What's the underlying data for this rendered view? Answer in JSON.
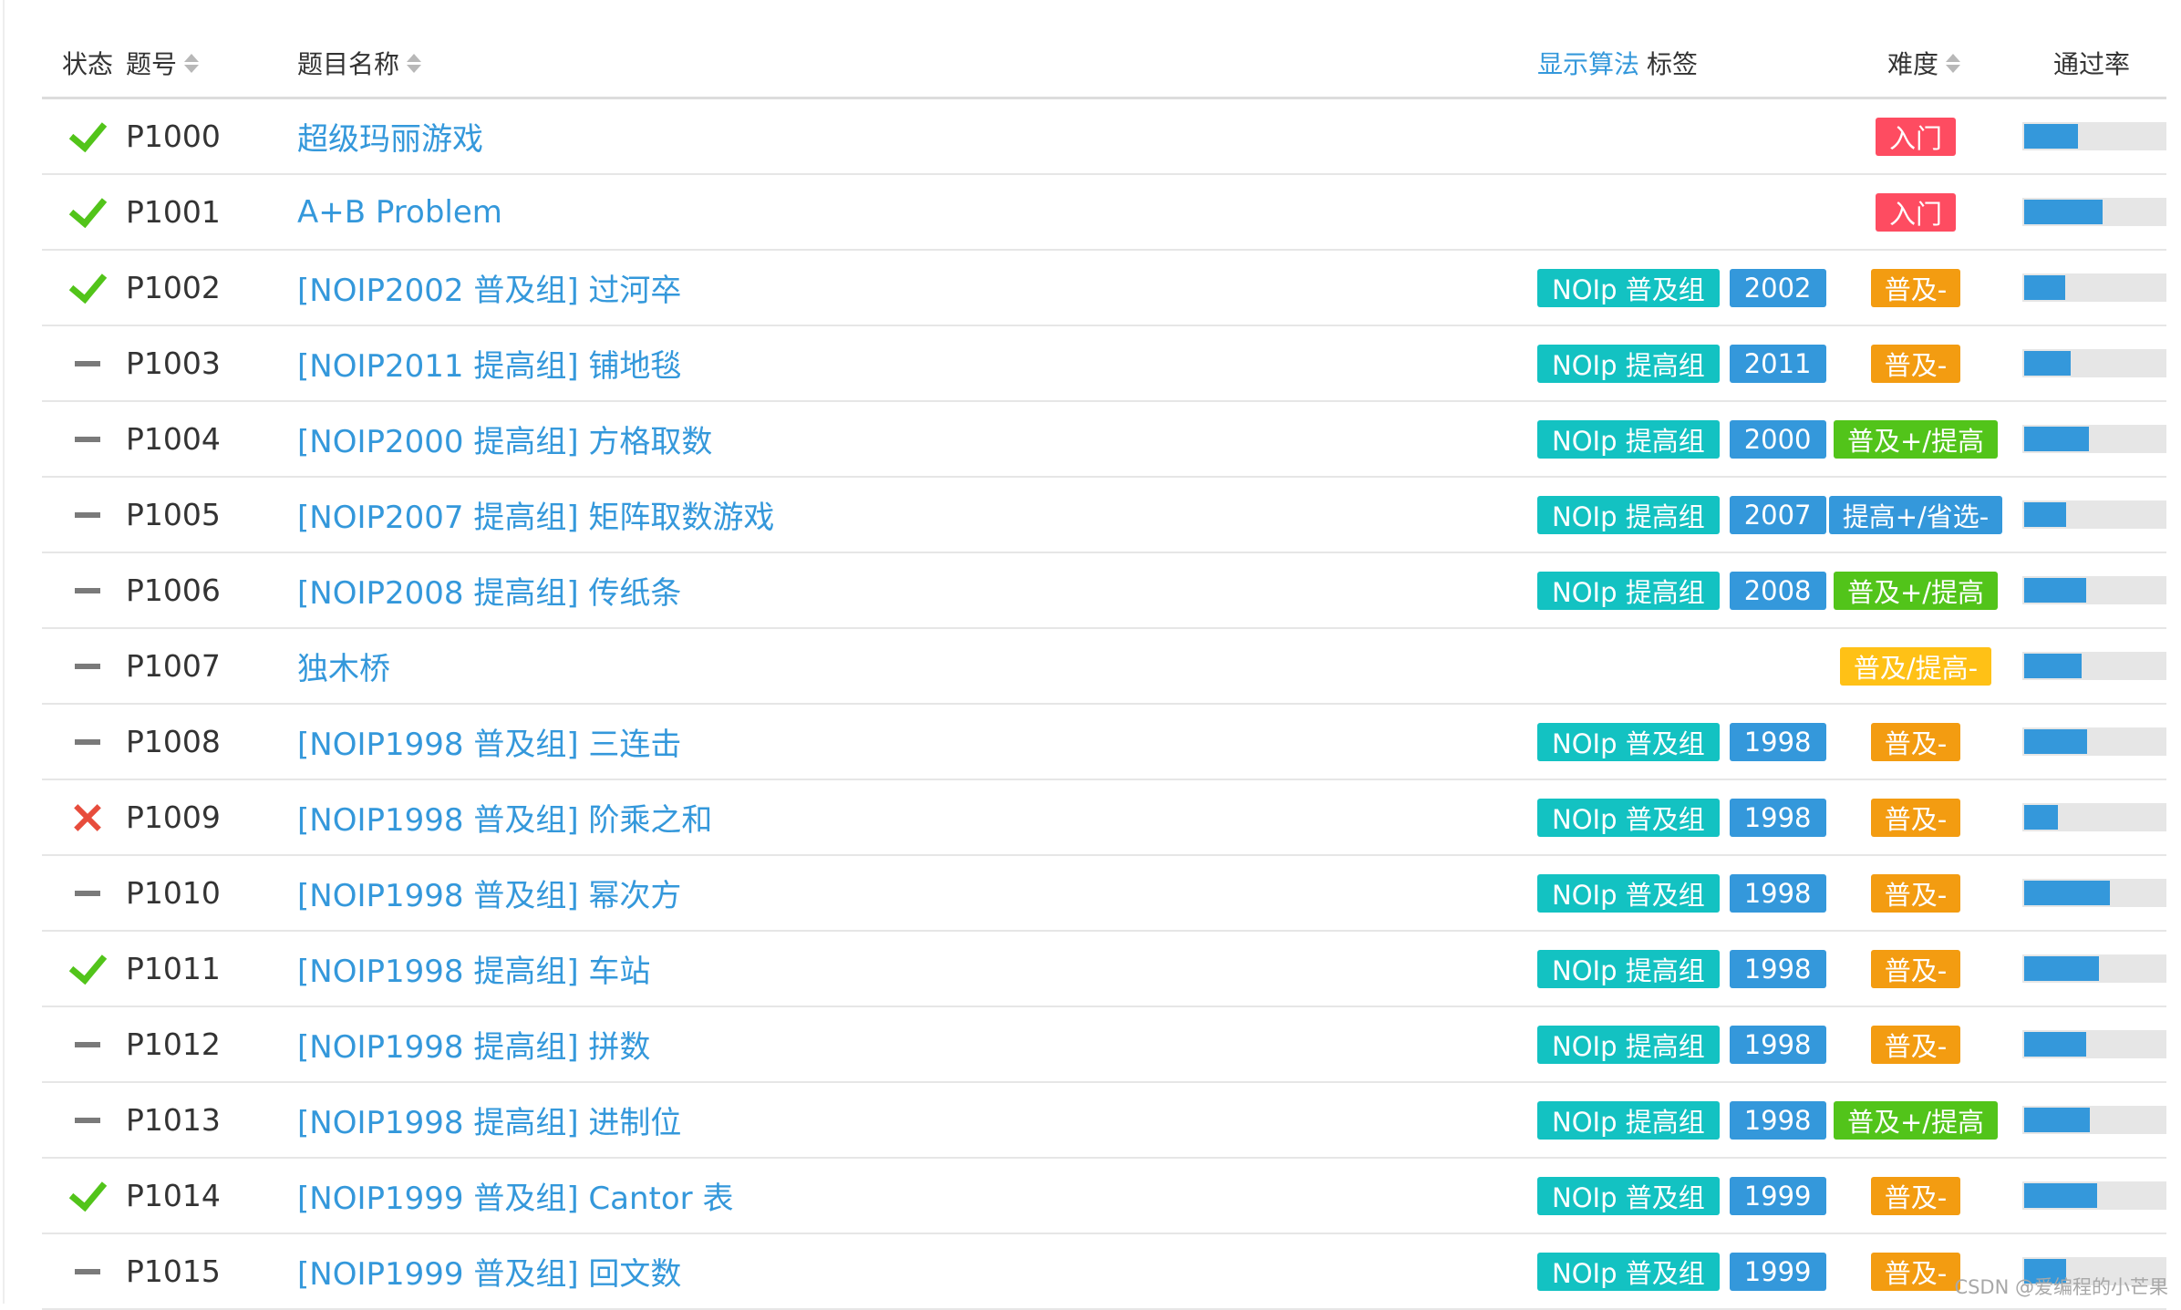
{
  "header": {
    "status": "状态",
    "pid": "题号",
    "title": "题目名称",
    "show_algo": "显示算法",
    "tags": "标签",
    "difficulty": "难度",
    "pass_rate": "通过率"
  },
  "colors": {
    "link": "#3498db",
    "accepted": "#52c41a",
    "wrong": "#e74c3c",
    "source_tag": "#13c2c2",
    "year_tag": "#3498db",
    "diff_entry": "#fe4c61",
    "diff_popular_minus": "#f39c11",
    "diff_popular_improve": "#52c41a",
    "diff_improve_province": "#3498db",
    "diff_popular_improve_minus": "#ffc116"
  },
  "problems": [
    {
      "status": "accepted",
      "pid": "P1000",
      "title": "超级玛丽游戏",
      "source": "",
      "year": "",
      "difficulty": "入门",
      "diff_color": "#fe4c61",
      "pass_rate": 0.38
    },
    {
      "status": "accepted",
      "pid": "P1001",
      "title": "A+B Problem",
      "source": "",
      "year": "",
      "difficulty": "入门",
      "diff_color": "#fe4c61",
      "pass_rate": 0.56
    },
    {
      "status": "accepted",
      "pid": "P1002",
      "title": "[NOIP2002 普及组] 过河卒",
      "source": "NOIp 普及组",
      "year": "2002",
      "difficulty": "普及-",
      "diff_color": "#f39c11",
      "pass_rate": 0.29
    },
    {
      "status": "none",
      "pid": "P1003",
      "title": "[NOIP2011 提高组] 铺地毯",
      "source": "NOIp 提高组",
      "year": "2011",
      "difficulty": "普及-",
      "diff_color": "#f39c11",
      "pass_rate": 0.33
    },
    {
      "status": "none",
      "pid": "P1004",
      "title": "[NOIP2000 提高组] 方格取数",
      "source": "NOIp 提高组",
      "year": "2000",
      "difficulty": "普及+/提高",
      "diff_color": "#52c41a",
      "pass_rate": 0.46
    },
    {
      "status": "none",
      "pid": "P1005",
      "title": "[NOIP2007 提高组] 矩阵取数游戏",
      "source": "NOIp 提高组",
      "year": "2007",
      "difficulty": "提高+/省选-",
      "diff_color": "#3498db",
      "pass_rate": 0.3
    },
    {
      "status": "none",
      "pid": "P1006",
      "title": "[NOIP2008 提高组] 传纸条",
      "source": "NOIp 提高组",
      "year": "2008",
      "difficulty": "普及+/提高",
      "diff_color": "#52c41a",
      "pass_rate": 0.44
    },
    {
      "status": "none",
      "pid": "P1007",
      "title": "独木桥",
      "source": "",
      "year": "",
      "difficulty": "普及/提高-",
      "diff_color": "#ffc116",
      "pass_rate": 0.41
    },
    {
      "status": "none",
      "pid": "P1008",
      "title": "[NOIP1998 普及组] 三连击",
      "source": "NOIp 普及组",
      "year": "1998",
      "difficulty": "普及-",
      "diff_color": "#f39c11",
      "pass_rate": 0.45
    },
    {
      "status": "wrong",
      "pid": "P1009",
      "title": "[NOIP1998 普及组] 阶乘之和",
      "source": "NOIp 普及组",
      "year": "1998",
      "difficulty": "普及-",
      "diff_color": "#f39c11",
      "pass_rate": 0.24
    },
    {
      "status": "none",
      "pid": "P1010",
      "title": "[NOIP1998 普及组] 幂次方",
      "source": "NOIp 普及组",
      "year": "1998",
      "difficulty": "普及-",
      "diff_color": "#f39c11",
      "pass_rate": 0.61
    },
    {
      "status": "accepted",
      "pid": "P1011",
      "title": "[NOIP1998 提高组] 车站",
      "source": "NOIp 提高组",
      "year": "1998",
      "difficulty": "普及-",
      "diff_color": "#f39c11",
      "pass_rate": 0.53
    },
    {
      "status": "none",
      "pid": "P1012",
      "title": "[NOIP1998 提高组] 拼数",
      "source": "NOIp 提高组",
      "year": "1998",
      "difficulty": "普及-",
      "diff_color": "#f39c11",
      "pass_rate": 0.44
    },
    {
      "status": "none",
      "pid": "P1013",
      "title": "[NOIP1998 提高组] 进制位",
      "source": "NOIp 提高组",
      "year": "1998",
      "difficulty": "普及+/提高",
      "diff_color": "#52c41a",
      "pass_rate": 0.47
    },
    {
      "status": "accepted",
      "pid": "P1014",
      "title": "[NOIP1999 普及组] Cantor 表",
      "source": "NOIp 普及组",
      "year": "1999",
      "difficulty": "普及-",
      "diff_color": "#f39c11",
      "pass_rate": 0.52
    },
    {
      "status": "none",
      "pid": "P1015",
      "title": "[NOIP1999 普及组] 回文数",
      "source": "NOIp 普及组",
      "year": "1999",
      "difficulty": "普及-",
      "diff_color": "#f39c11",
      "pass_rate": 0.3
    }
  ],
  "watermark": "CSDN @爱编程的小芒果"
}
